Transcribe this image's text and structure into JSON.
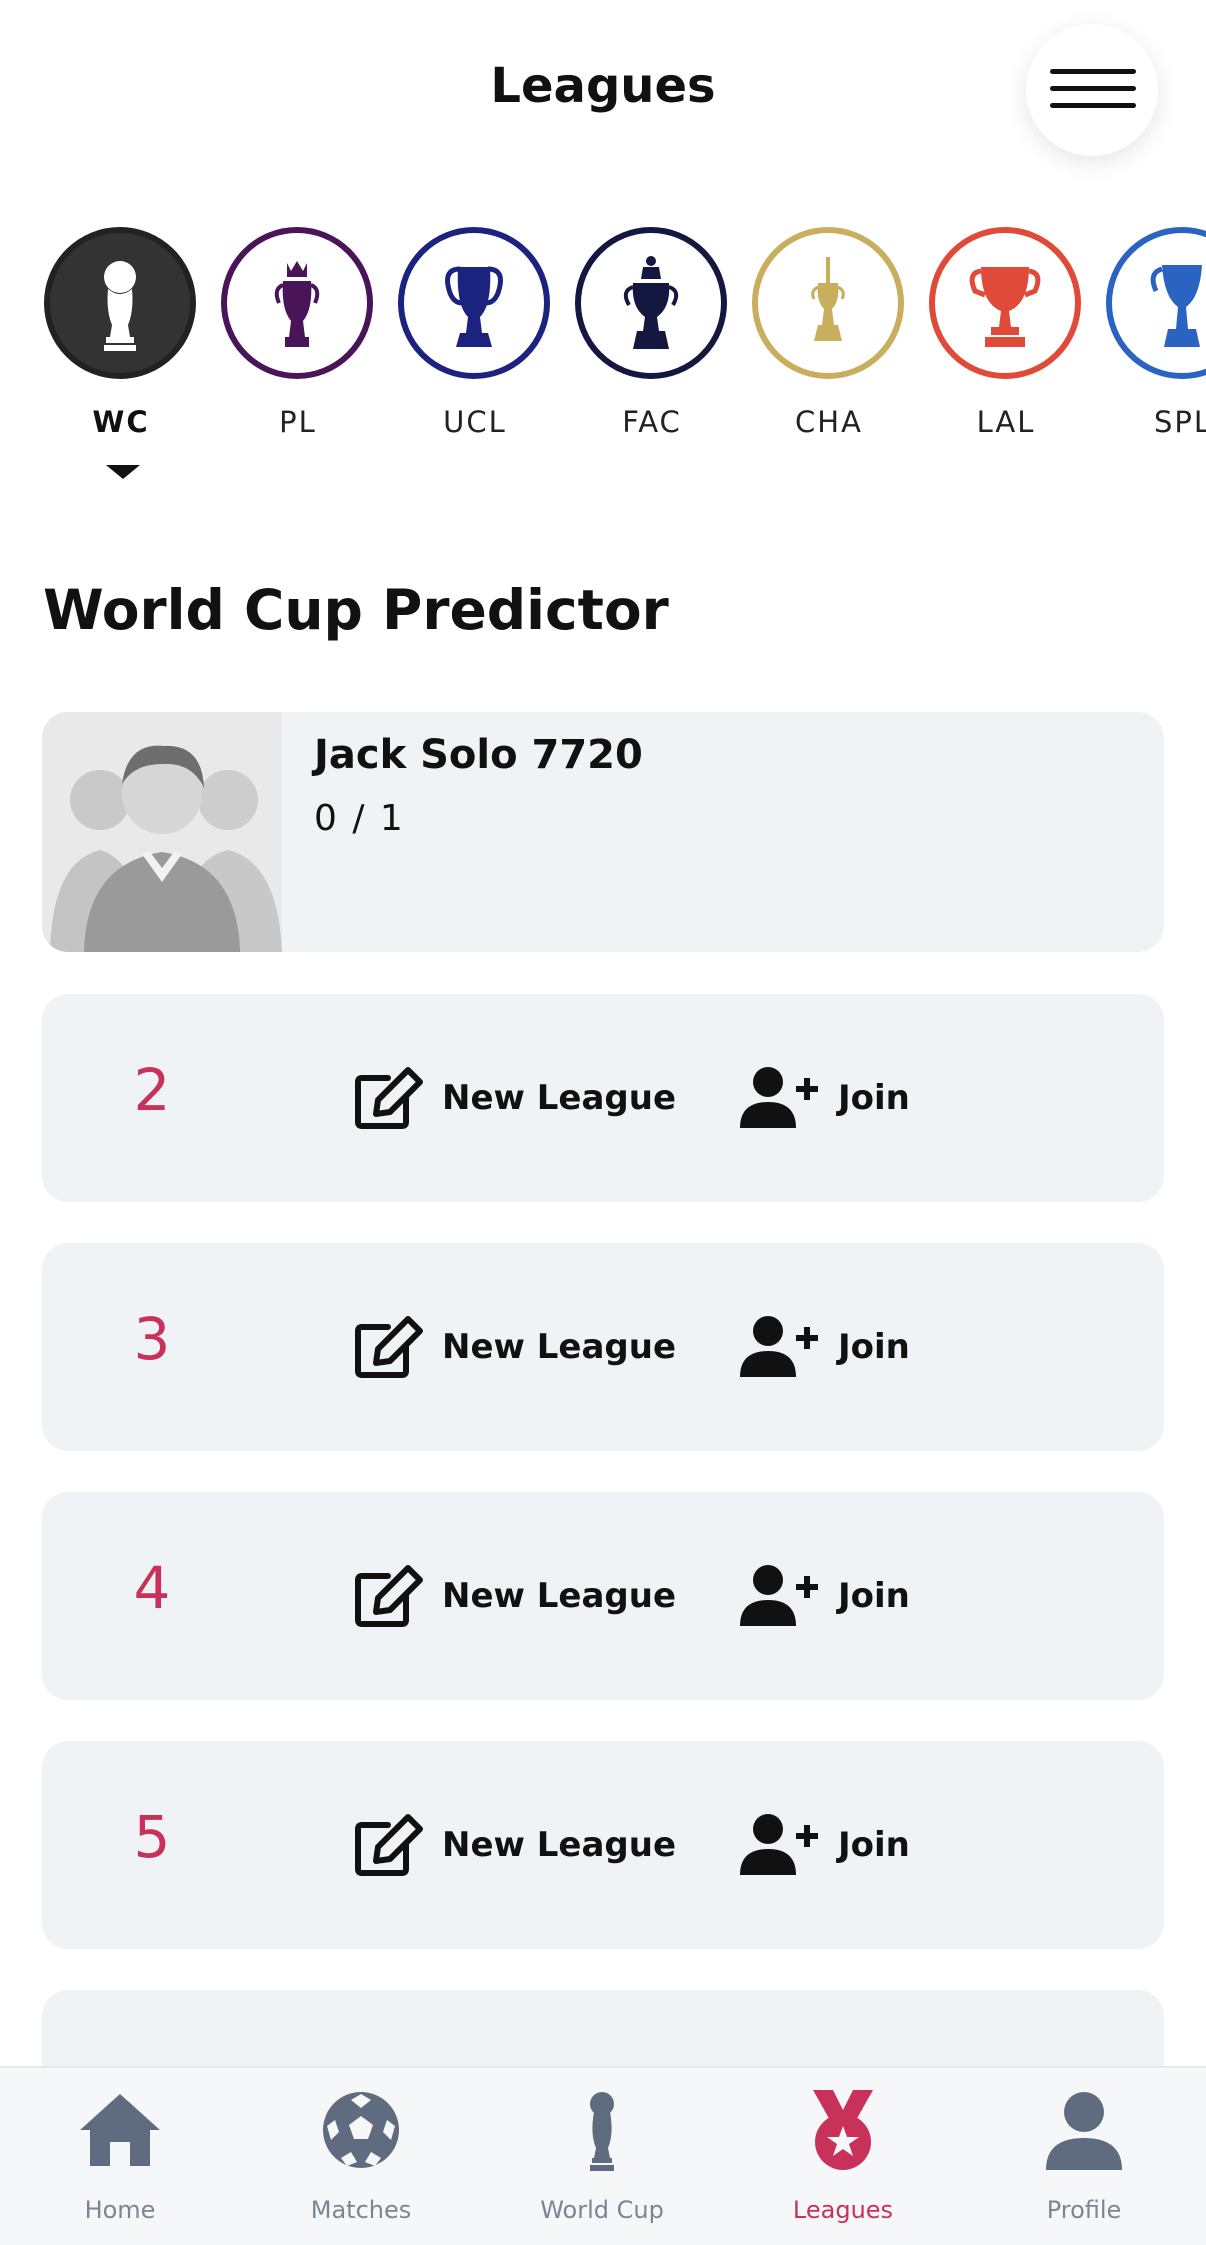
{
  "header": {
    "title": "Leagues",
    "menu_icon": "hamburger-menu-icon"
  },
  "leagues": [
    {
      "abbr": "WC",
      "active": true,
      "color": "#333333",
      "icon": "world-cup-trophy-icon"
    },
    {
      "abbr": "PL",
      "active": false,
      "color": "#4a1459",
      "icon": "premier-league-trophy-icon"
    },
    {
      "abbr": "UCL",
      "active": false,
      "color": "#1b237e",
      "icon": "champions-league-trophy-icon"
    },
    {
      "abbr": "FAC",
      "active": false,
      "color": "#14173f",
      "icon": "fa-cup-trophy-icon"
    },
    {
      "abbr": "CHA",
      "active": false,
      "color": "#c9ae5d",
      "icon": "championship-trophy-icon"
    },
    {
      "abbr": "LAL",
      "active": false,
      "color": "#e04a38",
      "icon": "la-liga-trophy-icon"
    },
    {
      "abbr": "SPL",
      "active": false,
      "color": "#2a63c2",
      "icon": "spl-trophy-icon"
    }
  ],
  "section": {
    "title": "World Cup Predictor"
  },
  "profile": {
    "name": "Jack Solo 7720",
    "score": "0 / 1",
    "avatar_icon": "group-avatar-icon"
  },
  "slots": [
    {
      "number": "2",
      "new_label": "New League",
      "join_label": "Join"
    },
    {
      "number": "3",
      "new_label": "New League",
      "join_label": "Join"
    },
    {
      "number": "4",
      "new_label": "New League",
      "join_label": "Join"
    },
    {
      "number": "5",
      "new_label": "New League",
      "join_label": "Join"
    }
  ],
  "tabbar": {
    "items": [
      {
        "label": "Home",
        "icon": "home-icon",
        "active": false
      },
      {
        "label": "Matches",
        "icon": "soccer-ball-icon",
        "active": false
      },
      {
        "label": "World Cup",
        "icon": "world-cup-trophy-icon",
        "active": false
      },
      {
        "label": "Leagues",
        "icon": "medal-icon",
        "active": true
      },
      {
        "label": "Profile",
        "icon": "user-icon",
        "active": false
      }
    ]
  },
  "colors": {
    "accent": "#c8325a",
    "card_bg": "#f0f3f6",
    "tab_inactive": "#7a8595"
  }
}
